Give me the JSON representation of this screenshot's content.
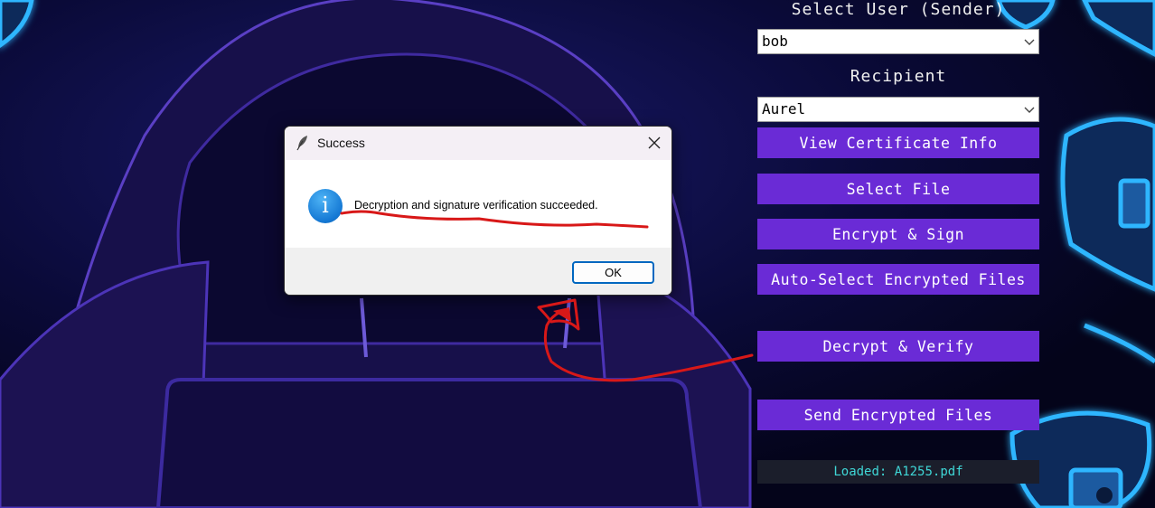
{
  "panel": {
    "sender_label": "Select User (Sender)",
    "sender_value": "bob",
    "recipient_label": "Recipient",
    "recipient_value": "Aurel",
    "buttons": {
      "view_cert": "View Certificate Info",
      "select_file": "Select File",
      "encrypt_sign": "Encrypt & Sign",
      "auto_select": "Auto-Select Encrypted Files",
      "decrypt_verify": "Decrypt & Verify",
      "send": "Send Encrypted Files"
    },
    "status": "Loaded: A1255.pdf"
  },
  "dialog": {
    "title": "Success",
    "message": "Decryption and signature verification succeeded.",
    "ok_label": "OK",
    "icon": "info-icon",
    "window_icon": "feather-icon"
  },
  "colors": {
    "button_purple": "#6a2bd6",
    "status_text": "#3fd6d6",
    "annotation_red": "#d81818",
    "neon_blue": "#2fb6ff"
  }
}
